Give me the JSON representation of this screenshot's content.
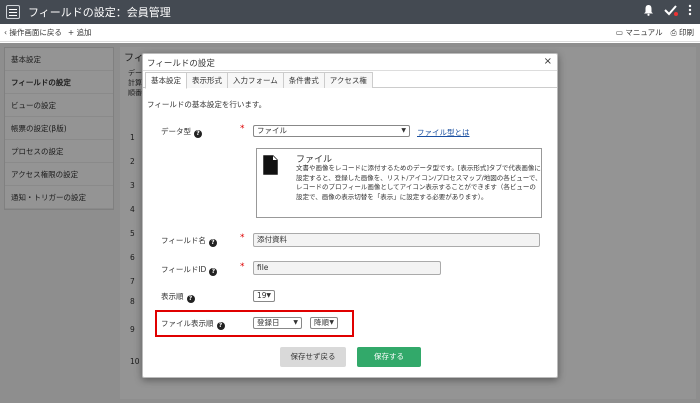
{
  "app": {
    "title": "フィールドの設定：会員管理"
  },
  "subbar": {
    "back": "操作画面に戻る",
    "add": "追加",
    "manual": "マニュアル",
    "print": "印刷"
  },
  "sidebar": {
    "items": [
      {
        "label": "基本設定"
      },
      {
        "label": "フィールドの設定"
      },
      {
        "label": "ビューの設定"
      },
      {
        "label": "帳票の設定(β版)"
      },
      {
        "label": "プロセスの設定"
      },
      {
        "label": "アクセス権限の設定"
      },
      {
        "label": "通知・トリガーの設定"
      }
    ]
  },
  "background": {
    "title": "フィ",
    "lines": [
      "デー",
      "計算",
      "順番"
    ],
    "row_numbers": [
      "1",
      "2",
      "3",
      "4",
      "5",
      "6",
      "7",
      "8",
      "9",
      "10"
    ]
  },
  "modal": {
    "title": "フィールドの設定",
    "close": "×",
    "tabs": [
      "基本設定",
      "表示形式",
      "入力フォーム",
      "条件書式",
      "アクセス権"
    ],
    "intro": "フィールドの基本設定を行います。",
    "data_type": {
      "label": "データ型",
      "value": "ファイル",
      "help_link": "ファイル型とは"
    },
    "info": {
      "title": "ファイル",
      "text": "文書や画像をレコードに添付するためのデータ型です。[表示形式]タブで代表画像に設定すると、登録した画像を、リスト/アイコン/プロセスマップ/地図の各ビューで、レコードのプロフィール画像としてアイコン表示することができます（各ビューの設定で、画像の表示切替を「表示」に設定する必要があります）。"
    },
    "field_name": {
      "label": "フィールド名",
      "value": "添付資料"
    },
    "field_id": {
      "label": "フィールドID",
      "value": "file"
    },
    "display_order": {
      "label": "表示順",
      "value": "19"
    },
    "file_order": {
      "label": "ファイル表示順",
      "sort_key": "登録日",
      "direction": "降順"
    },
    "buttons": {
      "cancel": "保存せず戻る",
      "save": "保存する"
    }
  },
  "colors": {
    "topbar": "#444a52",
    "accent_save": "#32a96a",
    "highlight": "#e00000",
    "required": "#dd0000"
  }
}
